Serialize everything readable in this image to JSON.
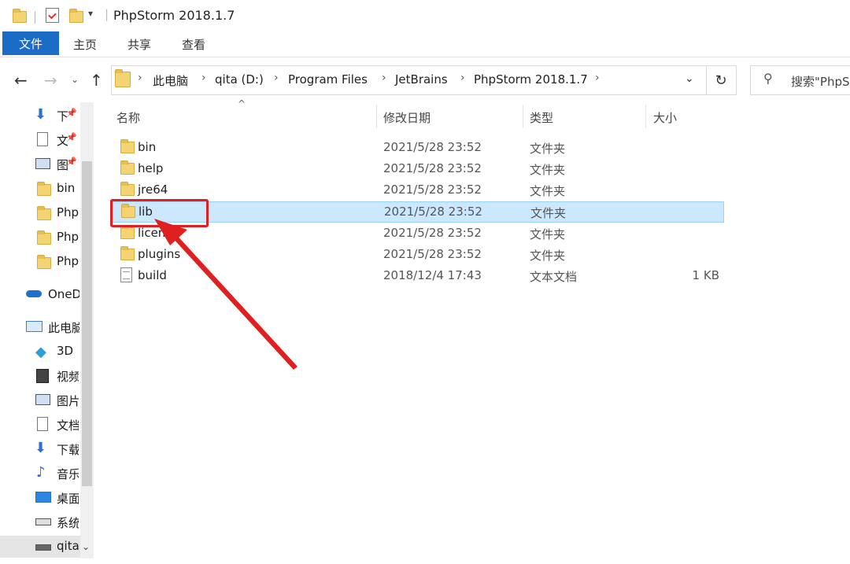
{
  "window": {
    "title": "PhpStorm 2018.1.7"
  },
  "ribbon": {
    "tabs": [
      "文件",
      "主页",
      "共享",
      "查看"
    ]
  },
  "address": {
    "crumbs": [
      "此电脑",
      "qita (D:)",
      "Program Files",
      "JetBrains",
      "PhpStorm 2018.1.7"
    ],
    "search_placeholder": "搜索\"PhpS"
  },
  "nav": {
    "quick": [
      {
        "label": "下",
        "icon": "download-arrow-icon"
      },
      {
        "label": "文",
        "icon": "document-icon"
      },
      {
        "label": "图",
        "icon": "picture-icon"
      },
      {
        "label": "bin",
        "icon": "folder-icon"
      },
      {
        "label": "Php",
        "icon": "folder-icon"
      },
      {
        "label": "Php",
        "icon": "folder-icon"
      },
      {
        "label": "Php",
        "icon": "folder-icon"
      }
    ],
    "onedrive": "OneD",
    "thispc": "此电脑",
    "pc_items": [
      {
        "label": "3D",
        "icon": "3d-objects-icon"
      },
      {
        "label": "视频",
        "icon": "video-icon"
      },
      {
        "label": "图片",
        "icon": "picture-icon"
      },
      {
        "label": "文档",
        "icon": "document-icon"
      },
      {
        "label": "下载",
        "icon": "download-arrow-icon"
      },
      {
        "label": "音乐",
        "icon": "music-note-icon"
      },
      {
        "label": "桌面",
        "icon": "desktop-icon"
      },
      {
        "label": "系统",
        "icon": "drive-icon"
      },
      {
        "label": "qita",
        "icon": "drive-icon"
      }
    ]
  },
  "list": {
    "headers": {
      "name": "名称",
      "date": "修改日期",
      "type": "类型",
      "size": "大小"
    },
    "rows": [
      {
        "name": "bin",
        "date": "2021/5/28 23:52",
        "type": "文件夹",
        "size": "",
        "kind": "folder"
      },
      {
        "name": "help",
        "date": "2021/5/28 23:52",
        "type": "文件夹",
        "size": "",
        "kind": "folder"
      },
      {
        "name": "jre64",
        "date": "2021/5/28 23:52",
        "type": "文件夹",
        "size": "",
        "kind": "folder"
      },
      {
        "name": "lib",
        "date": "2021/5/28 23:52",
        "type": "文件夹",
        "size": "",
        "kind": "folder"
      },
      {
        "name": "license",
        "date": "2021/5/28 23:52",
        "type": "文件夹",
        "size": "",
        "kind": "folder"
      },
      {
        "name": "plugins",
        "date": "2021/5/28 23:52",
        "type": "文件夹",
        "size": "",
        "kind": "folder"
      },
      {
        "name": "build",
        "date": "2018/12/4 17:43",
        "type": "文本文档",
        "size": "1 KB",
        "kind": "file"
      }
    ]
  },
  "colors": {
    "accent": "#1a6cc7",
    "selection": "#cce8ff",
    "annotation": "#e02020"
  }
}
